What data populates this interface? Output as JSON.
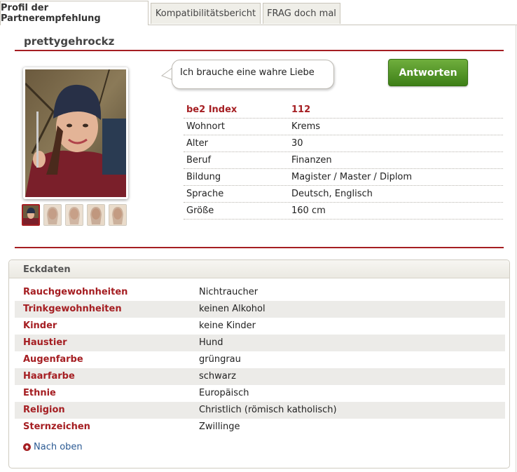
{
  "tabs": [
    {
      "label": "Profil der Partnerempfehlung"
    },
    {
      "label": "Kompatibilitätsbericht"
    },
    {
      "label": "FRAG doch mal"
    }
  ],
  "profile": {
    "username": "prettygehrockz",
    "quote": "Ich brauche eine wahre Liebe",
    "reply_label": "Antworten"
  },
  "summary": [
    {
      "key": "be2 Index",
      "value": "112"
    },
    {
      "key": "Wohnort",
      "value": "Krems"
    },
    {
      "key": "Alter",
      "value": "30"
    },
    {
      "key": "Beruf",
      "value": "Finanzen"
    },
    {
      "key": "Bildung",
      "value": "Magister / Master / Diplom"
    },
    {
      "key": "Sprache",
      "value": "Deutsch, Englisch"
    },
    {
      "key": "Größe",
      "value": "160 cm"
    }
  ],
  "eckdaten": {
    "title": "Eckdaten",
    "rows": [
      {
        "key": "Rauchgewohnheiten",
        "value": "Nichtraucher"
      },
      {
        "key": "Trinkgewohnheiten",
        "value": "keinen Alkohol"
      },
      {
        "key": "Kinder",
        "value": "keine Kinder"
      },
      {
        "key": "Haustier",
        "value": "Hund"
      },
      {
        "key": "Augenfarbe",
        "value": "grüngrau"
      },
      {
        "key": "Haarfarbe",
        "value": "schwarz"
      },
      {
        "key": "Ethnie",
        "value": "Europäisch"
      },
      {
        "key": "Religion",
        "value": "Christlich (römisch katholisch)"
      },
      {
        "key": "Sternzeichen",
        "value": "Zwillinge"
      }
    ],
    "back_to_top": "Nach oben"
  },
  "colors": {
    "accent": "#a51e22",
    "button_green": "#4f9126",
    "link": "#2b5a93"
  }
}
